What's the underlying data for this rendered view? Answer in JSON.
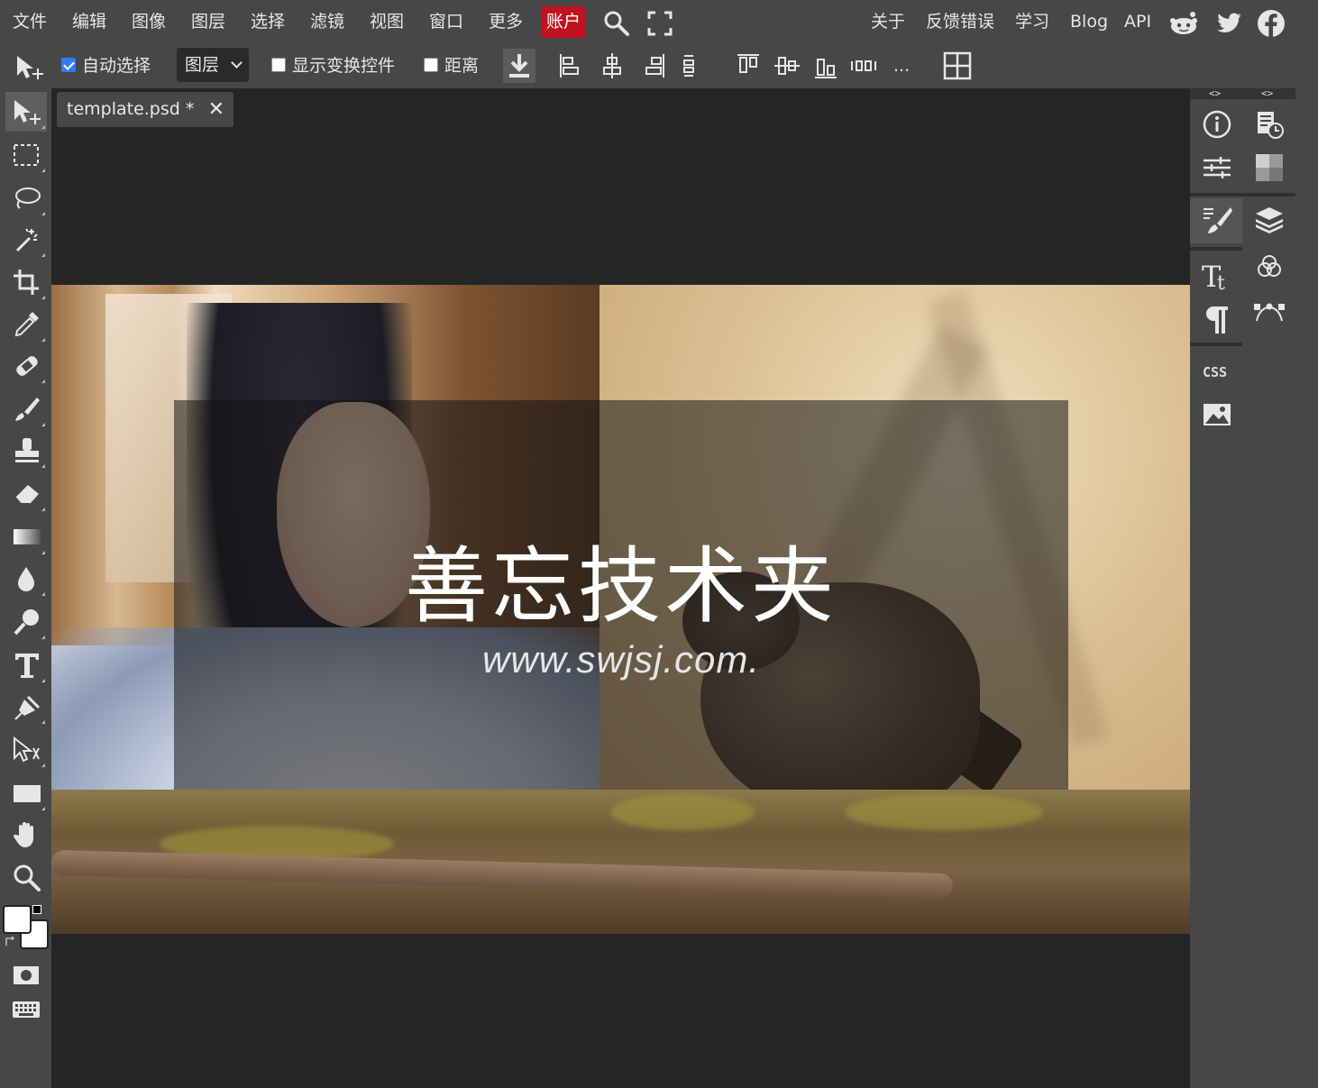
{
  "menubar": {
    "items": [
      "文件",
      "编辑",
      "图像",
      "图层",
      "选择",
      "滤镜",
      "视图",
      "窗口",
      "更多"
    ],
    "account": "账户",
    "right_links": [
      "关于",
      "反馈错误",
      "学习",
      "Blog",
      "API"
    ],
    "icons": [
      "search-icon",
      "fullscreen-icon",
      "reddit-icon",
      "twitter-icon",
      "facebook-icon"
    ],
    "account_color": "#c1121f"
  },
  "options": {
    "auto_select_label": "自动选择",
    "auto_select_checked": true,
    "layer_select_value": "图层",
    "show_transform_label": "显示变换控件",
    "show_transform_checked": false,
    "distance_label": "距离",
    "distance_checked": false,
    "more_label": "..."
  },
  "tools": [
    "move-tool-icon",
    "marquee-tool-icon",
    "lasso-tool-icon",
    "magic-wand-tool-icon",
    "crop-tool-icon",
    "eyedropper-tool-icon",
    "healing-tool-icon",
    "brush-tool-icon",
    "clone-stamp-tool-icon",
    "eraser-tool-icon",
    "gradient-tool-icon",
    "blur-tool-icon",
    "dodge-tool-icon",
    "type-tool-icon",
    "pen-tool-icon",
    "path-select-tool-icon",
    "rectangle-tool-icon",
    "hand-tool-icon",
    "zoom-tool-icon"
  ],
  "colors": {
    "foreground": "#ffffff",
    "background": "#ffffff"
  },
  "document": {
    "tab_title": "template.psd *",
    "close_label": "✕",
    "title_text": "善忘技术夹",
    "url_text": "www.swjsj.com."
  },
  "right_panel": {
    "collapse_left": "<>",
    "collapse_right": "<>",
    "css_label": "CSS"
  }
}
